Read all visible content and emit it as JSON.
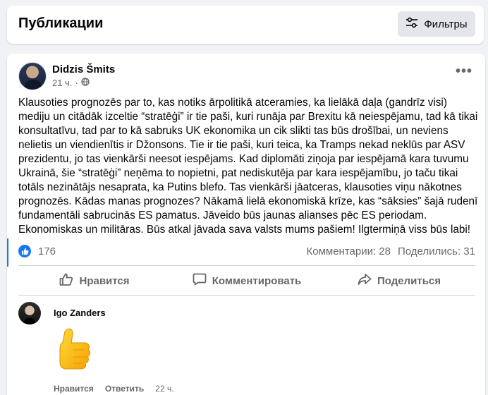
{
  "header": {
    "title": "Публикации",
    "filter_label": "Фильтры"
  },
  "post": {
    "author": "Didzis Šmits",
    "time": "21 ч.",
    "text": "Klausoties prognozēs par to, kas notiks ārpolitikā atceramies, ka lielākā daļa (gandrīz visi) mediju un citādāk izceltie “stratēģi” ir tie paši, kuri runāja par Brexitu kā neiespējamu, tad kā tikai konsultatīvu, tad par to kā sabruks UK ekonomika un cik slikti tas būs drošībai, un neviens nelietis un viendienītis ir Džonsons. Tie ir tie paši, kuri teica, ka Tramps nekad neklūs par ASV prezidentu, jo tas vienkārši neesot iespējams. Kad diplomāti ziņoja par iespējamā kara tuvumu Ukrainā, šie “stratēģi” neņēma to nopietni, pat nediskutēja par kara iespējamību, jo taču tikai totāls nezinātājs nesaprata, ka Putins blefo. Tas vienkārši jāatceras, klausoties viņu nākotnes prognozēs. Kādas manas prognozes? Nākamā lielā ekonomiskā krīze, kas “sāksies” šajā rudenī fundamentāli sabrucinās ES pamatus. Jāveido būs jaunas alianses pēc ES periodam. Ekonomiskas un militāras. Būs atkal jāvada sava valsts mums pašiem! Ilgtermiņā viss būs labi!",
    "likes": "176",
    "comments": "Комментарии: 28",
    "shares": "Поделились: 31"
  },
  "actions": {
    "like": "Нравится",
    "comment": "Комментировать",
    "share": "Поделиться"
  },
  "comment": {
    "author": "Igo Zanders",
    "like": "Нравится",
    "reply": "Ответить",
    "time": "22 ч."
  },
  "icons": {
    "filter": "sliders-icon",
    "globe": "globe-icon",
    "more": "more-horizontal-icon",
    "like": "thumbs-up-icon",
    "comment": "comment-bubble-icon",
    "share": "share-arrow-icon",
    "sticker": "thumbs-up-sticker"
  },
  "colors": {
    "accent": "#1877f2",
    "background": "#f0f2f5",
    "secondary_text": "#65676b"
  }
}
